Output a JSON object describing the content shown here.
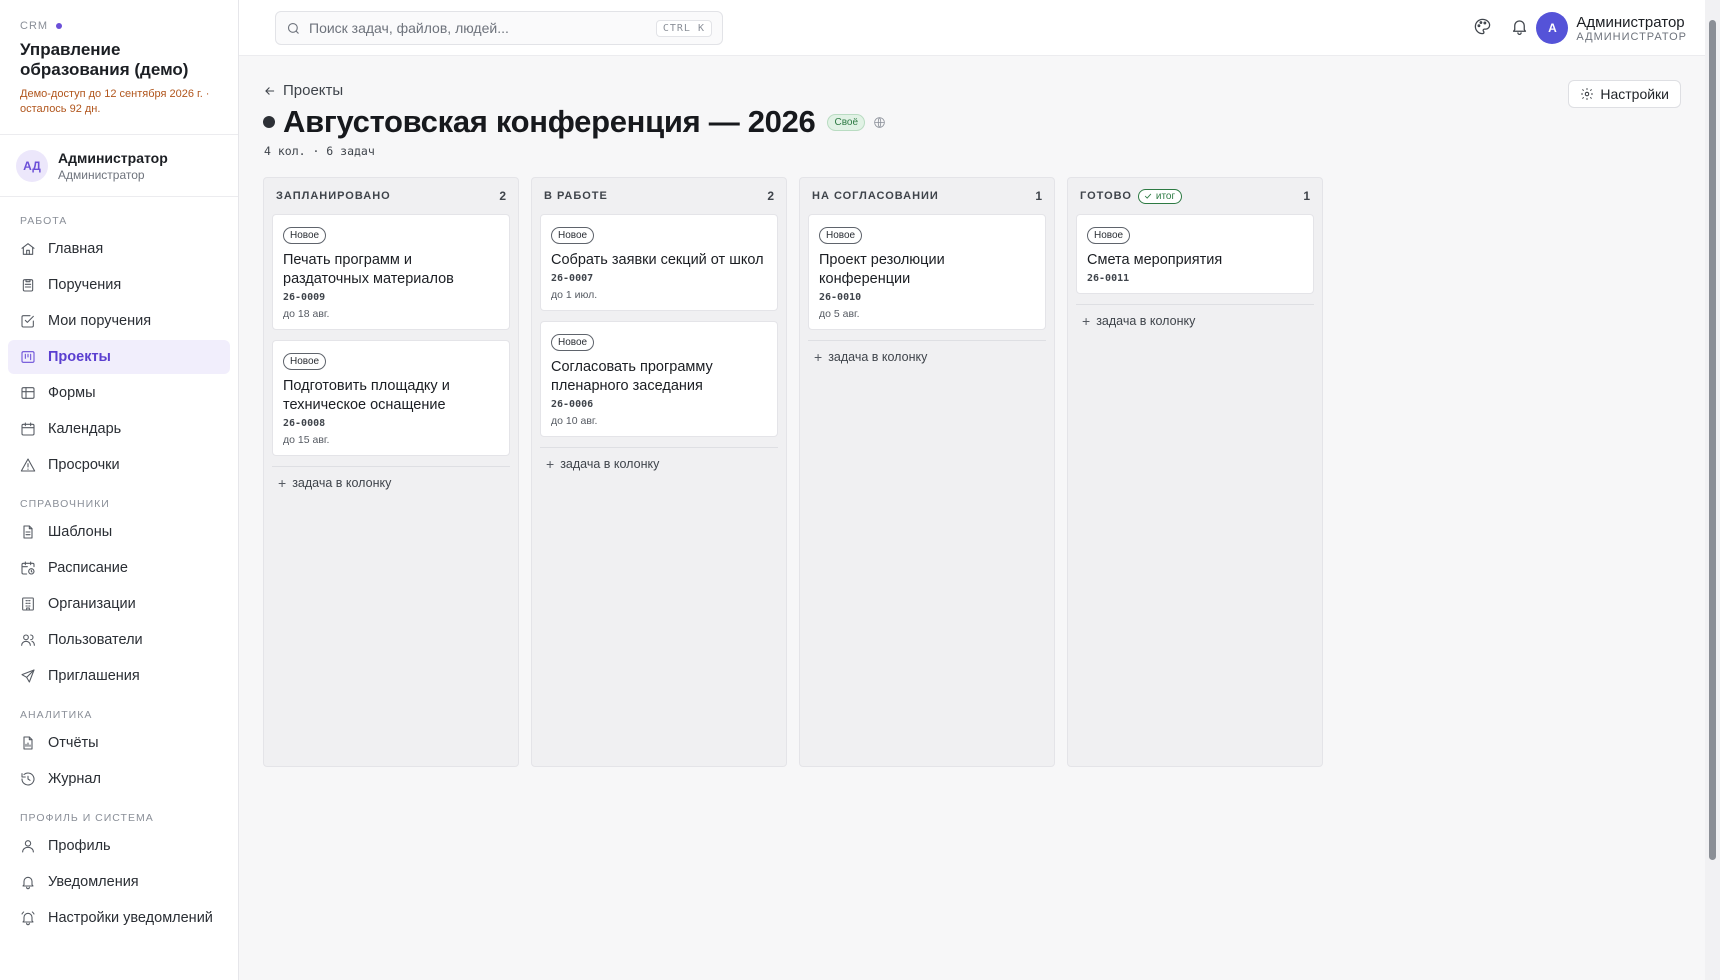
{
  "brand": {
    "label": "CRM",
    "title": "Управление образования (демо)",
    "note": "Демо-доступ до 12 сентября 2026 г. · осталось 92 дн."
  },
  "sidebar_user": {
    "initials": "АД",
    "name": "Администратор",
    "role": "Администратор"
  },
  "nav": {
    "sections": [
      {
        "title": "Работа",
        "items": [
          {
            "label": "Главная",
            "icon": "home-icon"
          },
          {
            "label": "Поручения",
            "icon": "clipboard-icon"
          },
          {
            "label": "Мои поручения",
            "icon": "check-square-icon"
          },
          {
            "label": "Проекты",
            "icon": "kanban-icon",
            "active": true
          },
          {
            "label": "Формы",
            "icon": "table-icon"
          },
          {
            "label": "Календарь",
            "icon": "calendar-icon"
          },
          {
            "label": "Просрочки",
            "icon": "alert-triangle-icon"
          }
        ]
      },
      {
        "title": "Справочники",
        "items": [
          {
            "label": "Шаблоны",
            "icon": "file-text-icon"
          },
          {
            "label": "Расписание",
            "icon": "calendar-clock-icon"
          },
          {
            "label": "Организации",
            "icon": "building-icon"
          },
          {
            "label": "Пользователи",
            "icon": "users-icon"
          },
          {
            "label": "Приглашения",
            "icon": "send-icon"
          }
        ]
      },
      {
        "title": "Аналитика",
        "items": [
          {
            "label": "Отчёты",
            "icon": "report-icon"
          },
          {
            "label": "Журнал",
            "icon": "history-icon"
          }
        ]
      },
      {
        "title": "Профиль и система",
        "items": [
          {
            "label": "Профиль",
            "icon": "user-icon"
          },
          {
            "label": "Уведомления",
            "icon": "bell-icon"
          },
          {
            "label": "Настройки уведомлений",
            "icon": "bell-ring-icon"
          }
        ]
      }
    ]
  },
  "topbar": {
    "search_placeholder": "Поиск задач, файлов, людей...",
    "shortcut": "CTRL K",
    "user": {
      "initial": "А",
      "name": "Администратор",
      "role": "Администратор"
    }
  },
  "project": {
    "back_label": "Проекты",
    "settings_label": "Настройки",
    "title": "Августовская конференция — 2026",
    "visibility_badge": "Своё",
    "meta": "4 кол. · 6 задач",
    "add_task_label": "задача в колонку"
  },
  "columns": [
    {
      "title": "Запланировано",
      "count": "2",
      "final": false,
      "cards": [
        {
          "status": "Новое",
          "title": "Печать программ и раздаточных материалов",
          "code": "26-0009",
          "due": "до 18 авг."
        },
        {
          "status": "Новое",
          "title": "Подготовить площадку и техническое оснащение",
          "code": "26-0008",
          "due": "до 15 авг."
        }
      ]
    },
    {
      "title": "В работе",
      "count": "2",
      "final": false,
      "cards": [
        {
          "status": "Новое",
          "title": "Собрать заявки секций от школ",
          "code": "26-0007",
          "due": "до 1 июл."
        },
        {
          "status": "Новое",
          "title": "Согласовать программу пленарного заседания",
          "code": "26-0006",
          "due": "до 10 авг."
        }
      ]
    },
    {
      "title": "На согласовании",
      "count": "1",
      "final": false,
      "cards": [
        {
          "status": "Новое",
          "title": "Проект резолюции конференции",
          "code": "26-0010",
          "due": "до 5 авг."
        }
      ]
    },
    {
      "title": "Готово",
      "count": "1",
      "final": true,
      "final_label": "итог",
      "cards": [
        {
          "status": "Новое",
          "title": "Смета мероприятия",
          "code": "26-0011",
          "due": ""
        }
      ]
    }
  ]
}
